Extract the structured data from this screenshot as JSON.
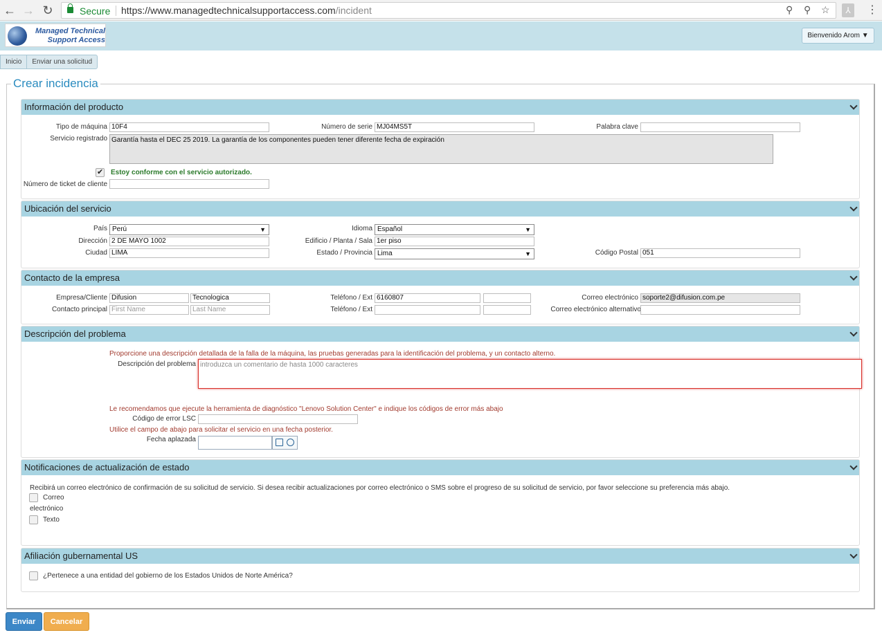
{
  "browser": {
    "secure_label": "Secure",
    "url_host": "https://www.managedtechnicalsupportaccess.com",
    "url_path": "/incident"
  },
  "header": {
    "logo_line1": "Managed Technical",
    "logo_line2": "Support Access",
    "welcome": "Bienvenido Arom ▼"
  },
  "breadcrumb": [
    "Inicio",
    "Enviar una solicitud"
  ],
  "page_title": "Crear incidencia",
  "product": {
    "title": "Información del producto",
    "machine_type_label": "Tipo de máquina",
    "machine_type": "10F4",
    "serial_label": "Número de serie",
    "serial": "MJ04MS5T",
    "keyword_label": "Palabra clave",
    "keyword": "",
    "service_label": "Servicio registrado",
    "service": "Garantía hasta el  DEC 25 2019. La garantía de los componentes pueden tener diferente fecha de expiración",
    "agree_label": "Estoy conforme con el servicio autorizado.",
    "ticket_label": "Número de ticket de cliente",
    "ticket": ""
  },
  "location": {
    "title": "Ubicación del servicio",
    "country_label": "País",
    "country": "Perú",
    "language_label": "Idioma",
    "language": "Español",
    "address_label": "Dirección",
    "address": "2 DE MAYO 1002",
    "building_label": "Edificio / Planta / Sala",
    "building": "1er piso",
    "city_label": "Ciudad",
    "city": "LIMA",
    "state_label": "Estado / Provincia",
    "state": "Lima",
    "zip_label": "Código Postal",
    "zip": "051"
  },
  "contact": {
    "title": "Contacto de la empresa",
    "company_label": "Empresa/Cliente",
    "company1": "Difusion",
    "company2": "Tecnologica",
    "phone_label": "Teléfono / Ext",
    "phone": "6160807",
    "ext": "",
    "email_label": "Correo electrónico",
    "email": "soporte2@difusion.com.pe",
    "main_contact_label": "Contacto principal",
    "first_name_ph": "First Name",
    "last_name_ph": "Last Name",
    "phone2_label": "Teléfono / Ext",
    "alt_email_label": "Correo electrónico alternativo"
  },
  "problem": {
    "title": "Descripción del problema",
    "instructions": "Proporcione una descripción detallada de la falla de la máquina, las pruebas generadas para la identificación del problema, y un contacto alterno.",
    "desc_label": "Descripción del problema",
    "desc_ph": "introduzca un comentario de hasta 1000 caracteres",
    "lsc_note": "Le recomendamos que ejecute la herramienta de diagnóstico \"Lenovo Solution Center\" e indique los códigos de error más abajo",
    "lsc_label": "Código de error LSC",
    "defer_note": "Utilice el campo de abajo para solicitar el servicio en una fecha posterior.",
    "defer_label": "Fecha aplazada"
  },
  "notifications": {
    "title": "Notificaciones de actualización de estado",
    "text": "Recibirá un correo electrónico de confirmación de su solicitud de servicio. Si desea recibir actualizaciones por correo electrónico o SMS sobre el progreso de su solicitud de servicio, por favor seleccione su preferencia más abajo.",
    "email_option_1": "Correo",
    "email_option_2": "electrónico",
    "text_option": "Texto"
  },
  "gov": {
    "title": "Afiliación gubernamental US",
    "question": "¿Pertenece a una entidad del gobierno de los Estados Unidos de Norte América?"
  },
  "buttons": {
    "send": "Enviar",
    "cancel": "Cancelar"
  }
}
